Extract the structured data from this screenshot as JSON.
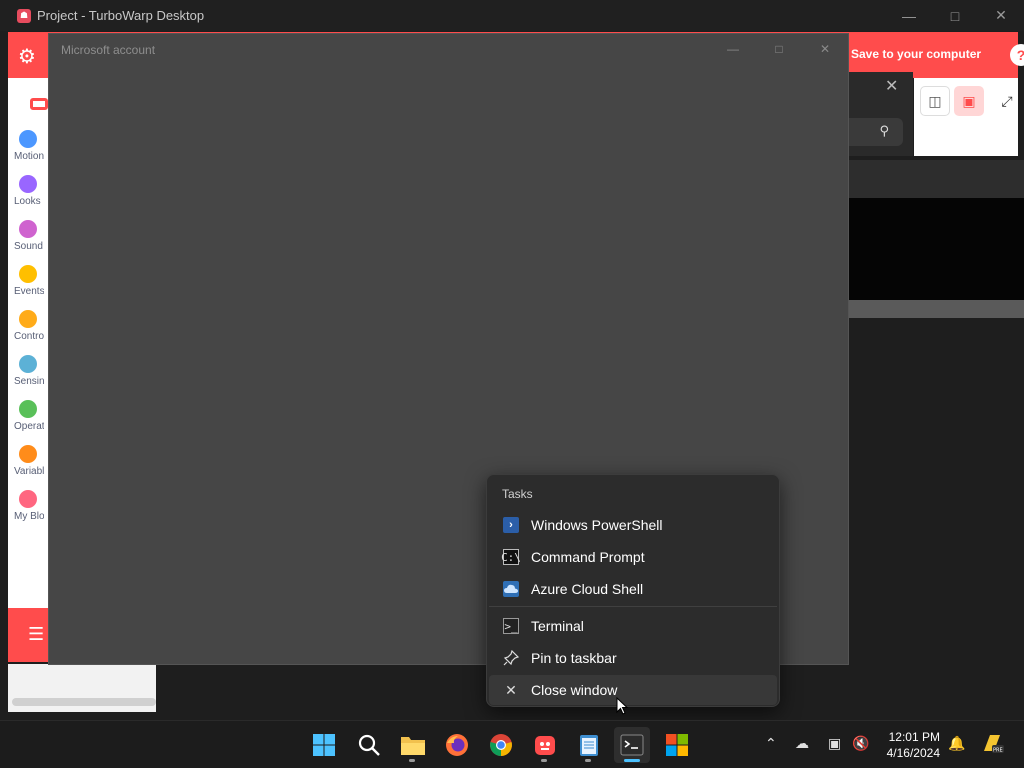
{
  "turbowarp": {
    "window_title": "Project - TurboWarp Desktop",
    "save_label": "Save to your computer",
    "help_glyph": "?",
    "categories": [
      {
        "label": "Motion",
        "color": "#4c97ff"
      },
      {
        "label": "Looks",
        "color": "#9966ff"
      },
      {
        "label": "Sound",
        "color": "#cf63cf"
      },
      {
        "label": "Events",
        "color": "#ffbf00"
      },
      {
        "label": "Control",
        "color": "#ffab19"
      },
      {
        "label": "Sensing",
        "color": "#5cb1d6"
      },
      {
        "label": "Operators",
        "color": "#59c059"
      },
      {
        "label": "Variables",
        "color": "#ff8c1a"
      },
      {
        "label": "My Blocks",
        "color": "#ff6680"
      }
    ]
  },
  "dialog": {
    "title": "Microsoft account"
  },
  "jumplist": {
    "header": "Tasks",
    "items": [
      {
        "label": "Windows PowerShell",
        "icon": "powershell-icon"
      },
      {
        "label": "Command Prompt",
        "icon": "command-prompt-icon"
      },
      {
        "label": "Azure Cloud Shell",
        "icon": "azure-cloud-shell-icon"
      },
      {
        "label": "Terminal",
        "icon": "terminal-icon"
      },
      {
        "label": "Pin to taskbar",
        "icon": "pin-icon"
      },
      {
        "label": "Close window",
        "icon": "close-icon"
      }
    ]
  },
  "taskbar": {
    "apps": [
      {
        "name": "start-button",
        "icon": "windows-logo-icon"
      },
      {
        "name": "search-button",
        "icon": "search-icon"
      },
      {
        "name": "file-explorer",
        "icon": "folder-icon"
      },
      {
        "name": "firefox",
        "icon": "firefox-icon"
      },
      {
        "name": "chrome",
        "icon": "chrome-icon"
      },
      {
        "name": "turbowarp",
        "icon": "turbowarp-icon"
      },
      {
        "name": "notepad",
        "icon": "notepad-icon"
      },
      {
        "name": "terminal",
        "icon": "terminal-icon"
      },
      {
        "name": "microsoft-store",
        "icon": "microsoft-store-icon"
      }
    ],
    "time": "12:01 PM",
    "date": "4/16/2024"
  },
  "colors": {
    "accent": "#ff4c4c",
    "taskbar_active": "#4cc2ff"
  }
}
